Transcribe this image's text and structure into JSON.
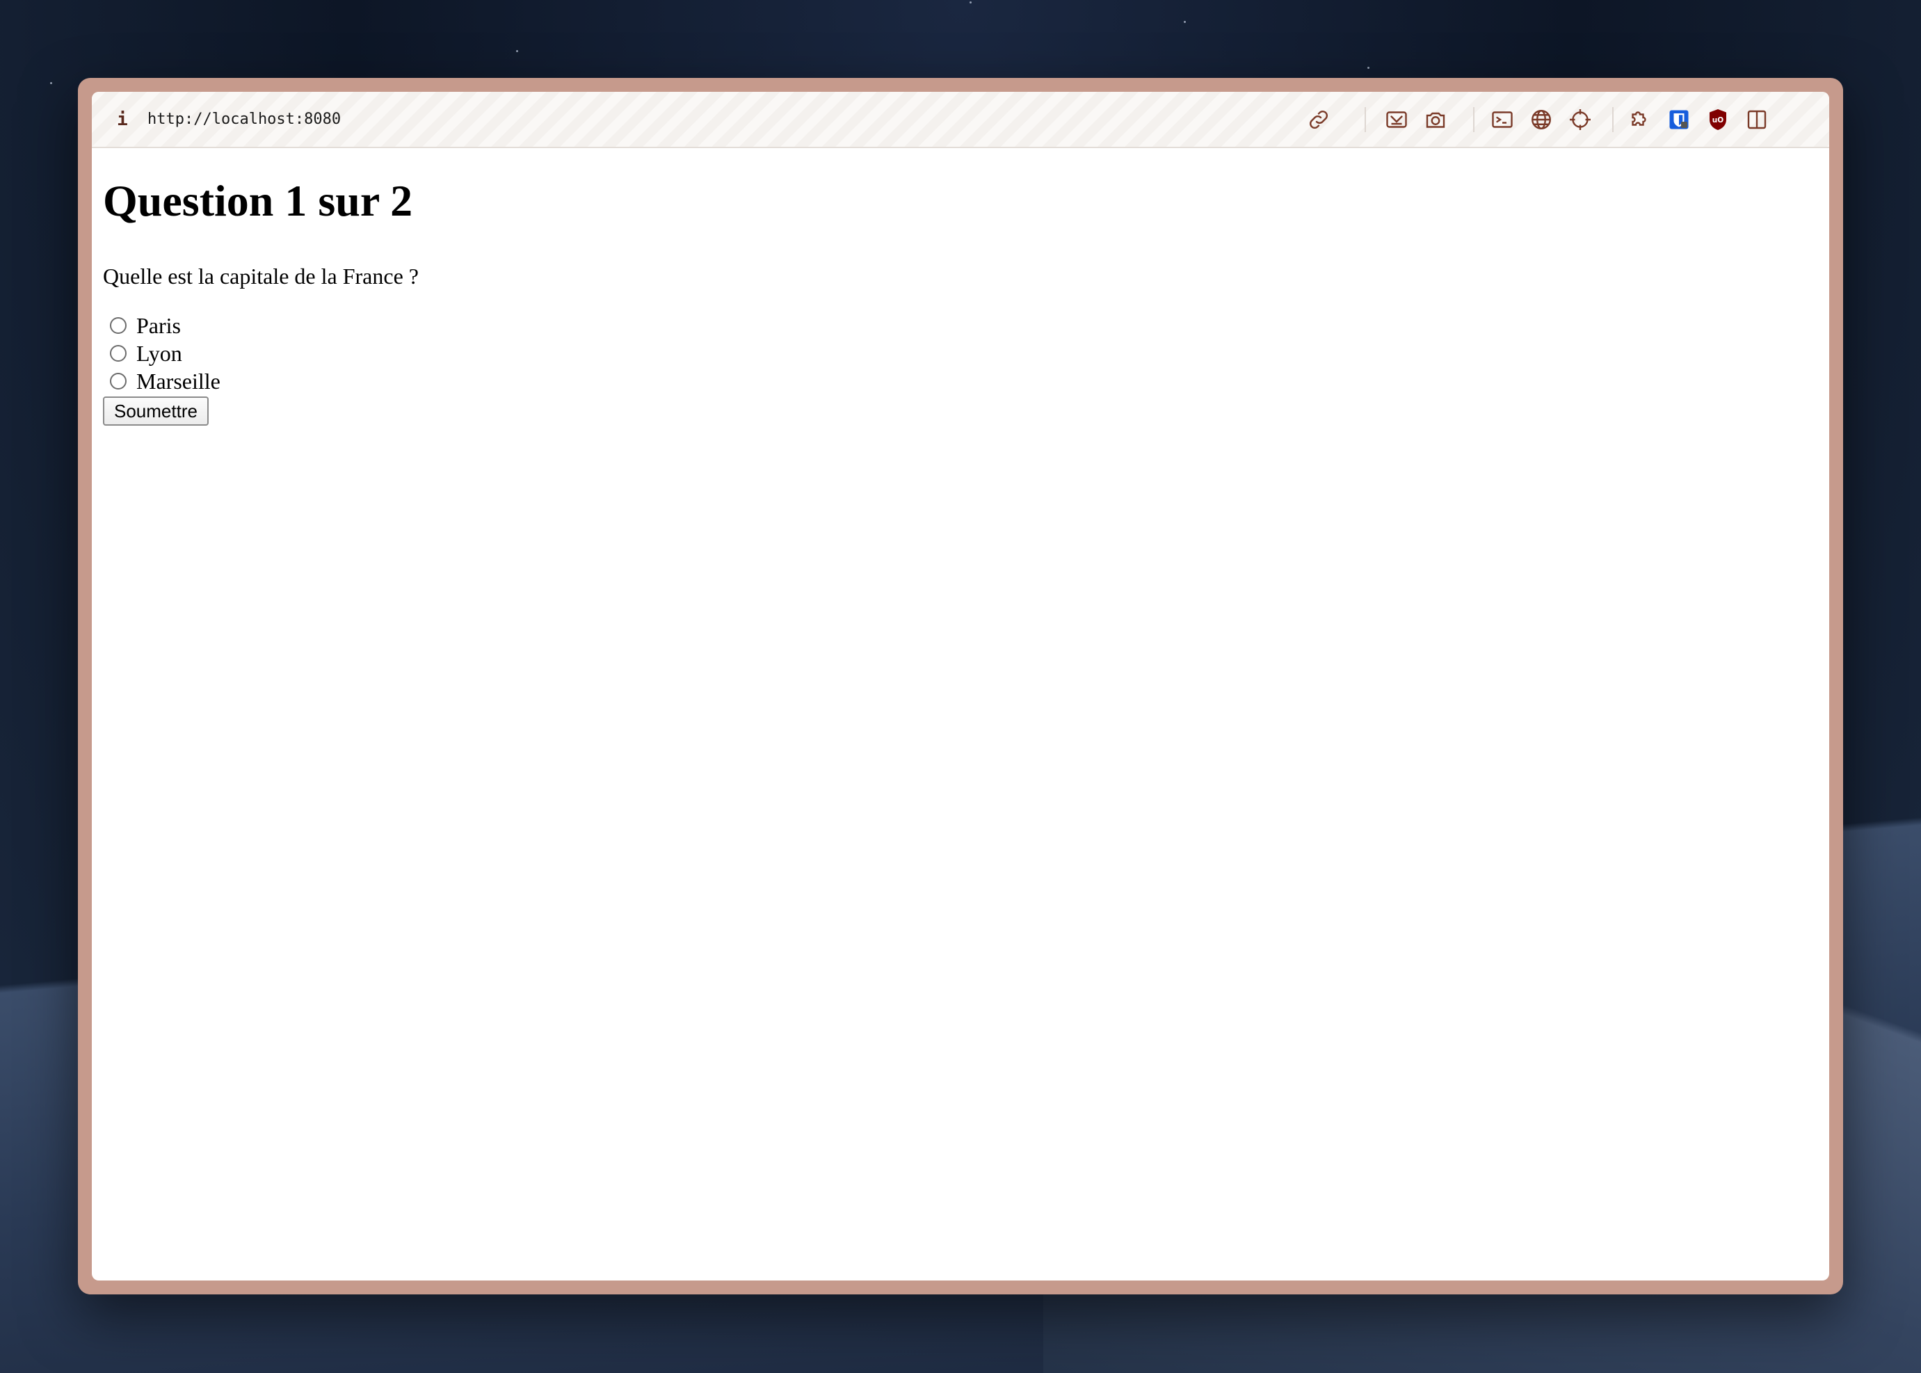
{
  "browser": {
    "url": "http://localhost:8080",
    "info_glyph": "i",
    "toolbar_icons": [
      "link-icon",
      "screenshot-area-icon",
      "camera-icon",
      "terminal-icon",
      "globe-icon",
      "crosshair-icon",
      "extensions-puzzle-icon",
      "bitwarden-icon",
      "ublock-origin-icon",
      "sidebar-toggle-icon"
    ],
    "ublock_badge": "uO"
  },
  "page": {
    "title": "Question 1 sur 2",
    "question": "Quelle est la capitale de la France ?",
    "options": [
      {
        "label": "Paris",
        "selected": false
      },
      {
        "label": "Lyon",
        "selected": false
      },
      {
        "label": "Marseille",
        "selected": false
      }
    ],
    "submit_label": "Soumettre"
  },
  "colors": {
    "frame": "#c69a8c",
    "toolbar_icon": "#7a3a28",
    "bitwarden": "#175ddc",
    "ublock": "#800000"
  }
}
